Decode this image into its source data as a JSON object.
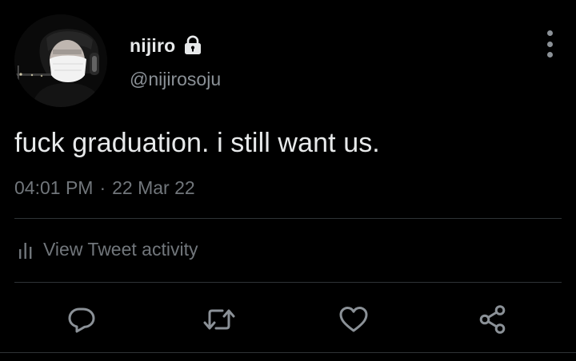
{
  "tweet": {
    "display_name": "nijiro",
    "handle": "@nijirosoju",
    "protected_icon": "lock-icon",
    "text": "fuck graduation. i still want us.",
    "time": "04:01 PM",
    "separator": "·",
    "date": "22 Mar 22"
  },
  "activity": {
    "icon": "bar-chart-icon",
    "label": "View Tweet activity"
  },
  "actions": [
    {
      "name": "reply",
      "icon": "reply-icon"
    },
    {
      "name": "retweet",
      "icon": "retweet-icon"
    },
    {
      "name": "like",
      "icon": "heart-icon"
    },
    {
      "name": "share",
      "icon": "share-icon"
    }
  ],
  "colors": {
    "background": "#000000",
    "primary_text": "#e7e9ea",
    "secondary_text": "#71767b",
    "divider": "#2f3336",
    "icon": "#8b9197"
  }
}
